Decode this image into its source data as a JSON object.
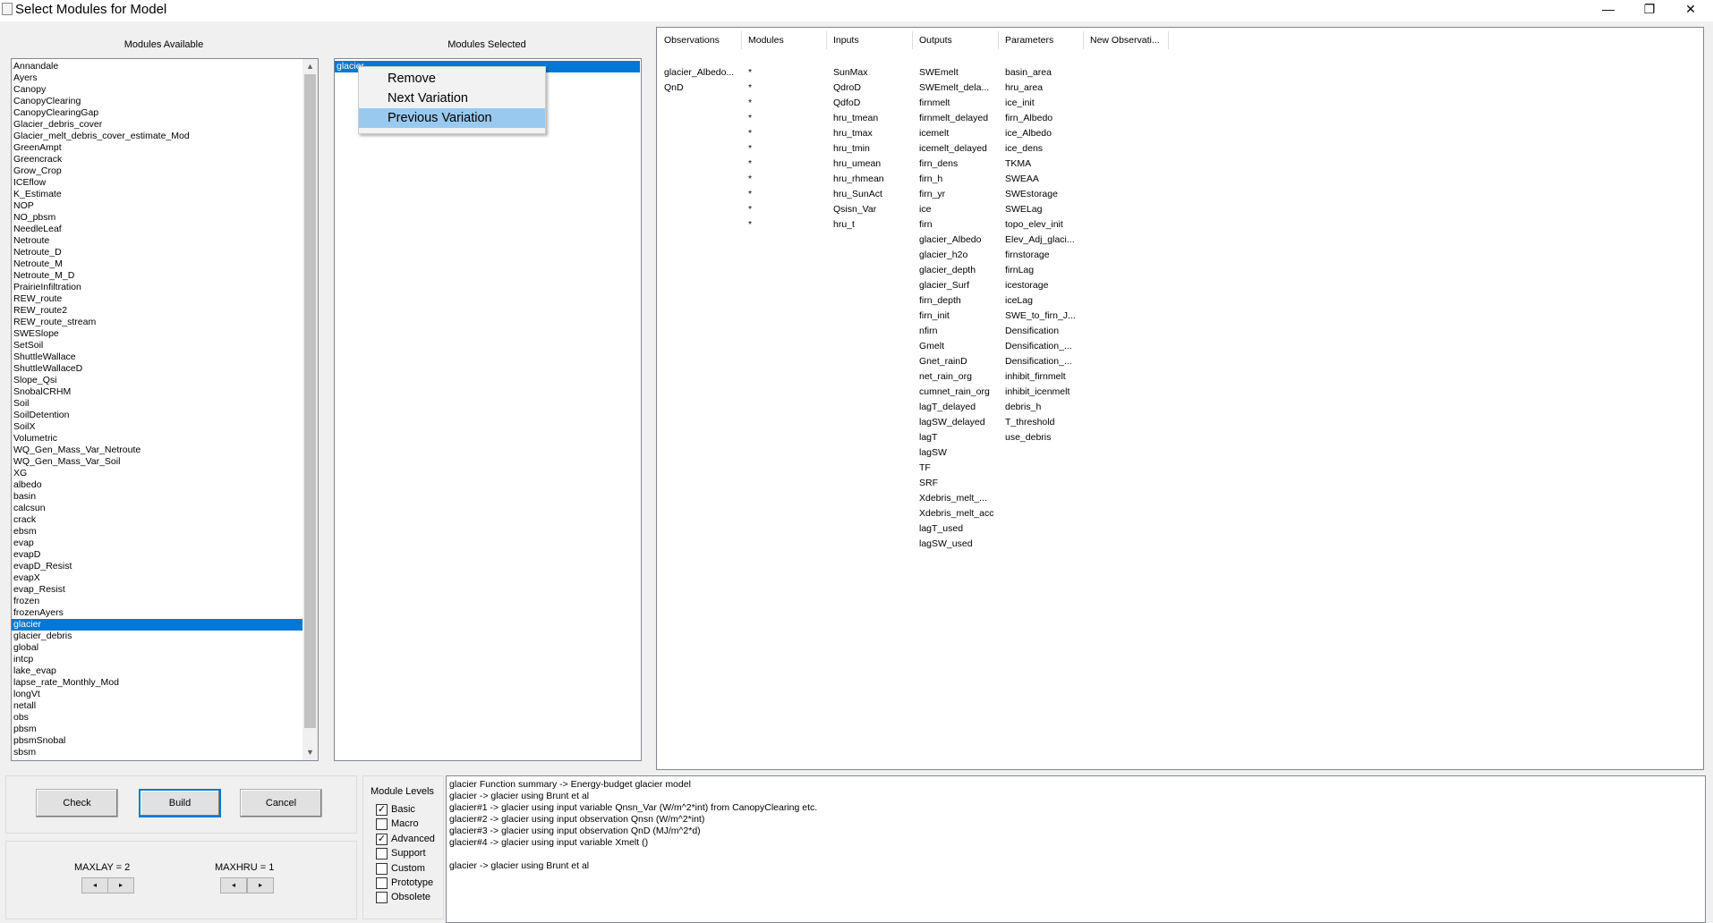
{
  "window": {
    "title": "Select Modules for Model",
    "min_glyph": "—",
    "restore_glyph": "❐",
    "close_glyph": "✕"
  },
  "available": {
    "label": "Modules Available",
    "items": [
      "Annandale",
      "Ayers",
      "Canopy",
      "CanopyClearing",
      "CanopyClearingGap",
      "Glacier_debris_cover",
      "Glacier_melt_debris_cover_estimate_Mod",
      "GreenAmpt",
      "Greencrack",
      "Grow_Crop",
      "ICEflow",
      "K_Estimate",
      "NOP",
      "NO_pbsm",
      "NeedleLeaf",
      "Netroute",
      "Netroute_D",
      "Netroute_M",
      "Netroute_M_D",
      "PrairieInfiltration",
      "REW_route",
      "REW_route2",
      "REW_route_stream",
      "SWESlope",
      "SetSoil",
      "ShuttleWallace",
      "ShuttleWallaceD",
      "Slope_Qsi",
      "SnobalCRHM",
      "Soil",
      "SoilDetention",
      "SoilX",
      "Volumetric",
      "WQ_Gen_Mass_Var_Netroute",
      "WQ_Gen_Mass_Var_Soil",
      "XG",
      "albedo",
      "basin",
      "calcsun",
      "crack",
      "ebsm",
      "evap",
      "evapD",
      "evapD_Resist",
      "evapX",
      "evap_Resist",
      "frozen",
      "frozenAyers",
      "glacier",
      "glacier_debris",
      "global",
      "intcp",
      "lake_evap",
      "lapse_rate_Monthly_Mod",
      "longVt",
      "netall",
      "obs",
      "pbsm",
      "pbsmSnobal",
      "sbsm"
    ],
    "selected_index": 48,
    "scroll_up": "▲",
    "scroll_down": "▼"
  },
  "selected": {
    "label": "Modules Selected",
    "items": [
      "glacier"
    ]
  },
  "context_menu": {
    "items": [
      "Remove",
      "Next Variation",
      "Previous Variation"
    ],
    "highlighted_index": 2
  },
  "grid": {
    "headers": [
      "Observations",
      "Modules",
      "Inputs",
      "Outputs",
      "Parameters",
      "New Observati..."
    ],
    "observations": [
      "glacier_Albedo...",
      "QnD"
    ],
    "modules": [
      "*",
      "*",
      "*",
      "*",
      "*",
      "*",
      "*",
      "*",
      "*",
      "*",
      "*"
    ],
    "inputs": [
      "SunMax",
      "QdroD",
      "QdfoD",
      "hru_tmean",
      "hru_tmax",
      "hru_tmin",
      "hru_umean",
      "hru_rhmean",
      "hru_SunAct",
      "Qsisn_Var",
      "hru_t"
    ],
    "outputs": [
      "SWEmelt",
      "SWEmelt_dela...",
      "firnmelt",
      "firnmelt_delayed",
      "icemelt",
      "icemelt_delayed",
      "firn_dens",
      "firn_h",
      "firn_yr",
      "ice",
      "firn",
      "glacier_Albedo",
      "glacier_h2o",
      "glacier_depth",
      "glacier_Surf",
      "firn_depth",
      "firn_init",
      "nfirn",
      "Gmelt",
      "Gnet_rainD",
      "net_rain_org",
      "cumnet_rain_org",
      "lagT_delayed",
      "lagSW_delayed",
      "lagT",
      "lagSW",
      "TF",
      "SRF",
      "Xdebris_melt_...",
      "Xdebris_melt_acc",
      "lagT_used",
      "lagSW_used"
    ],
    "parameters": [
      "basin_area",
      "hru_area",
      "ice_init",
      "firn_Albedo",
      "ice_Albedo",
      "ice_dens",
      "TKMA",
      "SWEAA",
      "SWEstorage",
      "SWELag",
      "topo_elev_init",
      "Elev_Adj_glaci...",
      "firnstorage",
      "firnLag",
      "icestorage",
      "iceLag",
      "SWE_to_firn_J...",
      "Densification",
      "Densification_...",
      "Densification_...",
      "inhibit_firnmelt",
      "inhibit_icenmelt",
      "debris_h",
      "T_threshold",
      "use_debris"
    ]
  },
  "buttons": {
    "check": "Check",
    "build": "Build",
    "cancel": "Cancel"
  },
  "maxlay": {
    "label": "MAXLAY =  2",
    "left": "◂",
    "right": "▸"
  },
  "maxhru": {
    "label": "MAXHRU = 1",
    "left": "◂",
    "right": "▸"
  },
  "levels": {
    "title": "Module Levels",
    "items": [
      {
        "label": "Basic",
        "checked": true
      },
      {
        "label": "Macro",
        "checked": false
      },
      {
        "label": "Advanced",
        "checked": true
      },
      {
        "label": "Support",
        "checked": false
      },
      {
        "label": "Custom",
        "checked": false
      },
      {
        "label": "Prototype",
        "checked": false
      },
      {
        "label": "Obsolete",
        "checked": false
      }
    ],
    "check_glyph": "✓"
  },
  "memo": {
    "lines": [
      "glacier Function summary -> Energy-budget glacier model",
      "glacier   -> glacier using Brunt et al",
      "glacier#1 -> glacier using input variable Qnsn_Var (W/m^2*int) from CanopyClearing etc.",
      "glacier#2 -> glacier using input observation Qnsn (W/m^2*int)",
      "glacier#3 -> glacier using input observation QnD (MJ/m^2*d)",
      "glacier#4 -> glacier using input variable Xmelt ()",
      "",
      "glacier -> glacier using Brunt et al"
    ]
  }
}
